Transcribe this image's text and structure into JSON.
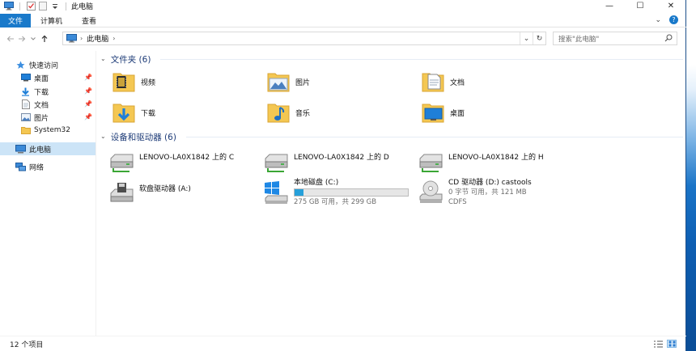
{
  "window": {
    "title": "此电脑",
    "controls": {
      "minimize": "—",
      "maximize": "☐",
      "close": "✕"
    }
  },
  "ribbon": {
    "tabs": [
      "文件",
      "计算机",
      "查看"
    ],
    "expand_glyph": "⌄",
    "help_glyph": "?"
  },
  "address": {
    "crumb": "此电脑",
    "dropdown_glyph": "⌄",
    "refresh_glyph": "↻",
    "search_placeholder": "搜索\"此电脑\""
  },
  "nav": {
    "quick_access": "快速访问",
    "items": [
      {
        "label": "桌面",
        "icon": "desktop-icon",
        "pinned": true
      },
      {
        "label": "下载",
        "icon": "download-icon",
        "pinned": true
      },
      {
        "label": "文档",
        "icon": "document-icon",
        "pinned": true
      },
      {
        "label": "图片",
        "icon": "picture-icon",
        "pinned": true
      },
      {
        "label": "System32",
        "icon": "folder-icon",
        "pinned": false
      }
    ],
    "this_pc": "此电脑",
    "network": "网络"
  },
  "folders": {
    "header": "文件夹 (6)",
    "items": [
      "视频",
      "图片",
      "文档",
      "下载",
      "音乐",
      "桌面"
    ]
  },
  "devices": {
    "header": "设备和驱动器 (6)",
    "network_drives": [
      "LENOVO-LA0X1842 上的 C",
      "LENOVO-LA0X1842 上的 D",
      "LENOVO-LA0X1842 上的 H"
    ],
    "floppy": "软盘驱动器 (A:)",
    "local_disk": {
      "name": "本地磁盘 (C:)",
      "free": "275 GB 可用，共 299 GB",
      "used_fraction": 0.08
    },
    "cd": {
      "name": "CD 驱动器 (D:) castools",
      "free": "0 字节 可用，共 121 MB",
      "fs": "CDFS"
    }
  },
  "status": {
    "count": "12 个项目"
  },
  "colors": {
    "accent": "#1979ca",
    "selected": "#cce4f7",
    "folder": "#f4c752",
    "group_header": "#1e3c78",
    "bar_fill": "#26a0da"
  }
}
